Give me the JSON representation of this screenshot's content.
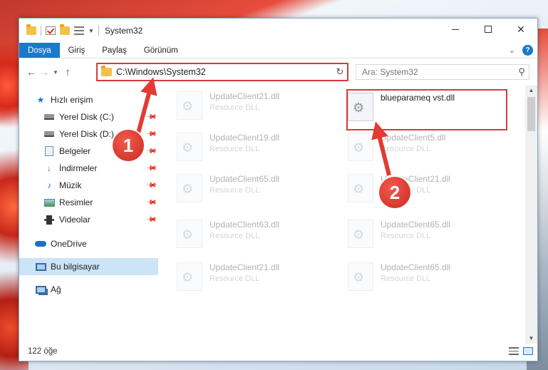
{
  "window": {
    "title": "System32"
  },
  "ribbon": {
    "tabs": [
      "Dosya",
      "Giriş",
      "Paylaş",
      "Görünüm"
    ]
  },
  "address": {
    "path": "C:\\Windows\\System32"
  },
  "search": {
    "placeholder": "Ara: System32"
  },
  "sidebar": {
    "quick_access": "Hızlı erişim",
    "items": [
      "Yerel Disk (C:)",
      "Yerel Disk (D:)",
      "Belgeler",
      "İndirmeler",
      "Müzik",
      "Resimler",
      "Videolar"
    ],
    "onedrive": "OneDrive",
    "this_pc": "Bu bilgisayar",
    "network": "Ağ"
  },
  "files": {
    "left": [
      {
        "name": "UpdateClient21.dll",
        "type": "Resource DLL"
      },
      {
        "name": "UpdateClient19.dll",
        "type": "Resource DLL"
      },
      {
        "name": "UpdateClient65.dll",
        "type": "Resource DLL"
      },
      {
        "name": "UpdateClient63.dll",
        "type": "Resource DLL"
      },
      {
        "name": "UpdateClient21.dll",
        "type": "Resource DLL"
      }
    ],
    "right": [
      {
        "name": "blueparameq vst.dll",
        "type": ""
      },
      {
        "name": "UpdateClient5.dll",
        "type": "Resource DLL"
      },
      {
        "name": "UpdateClient21.dll",
        "type": "Resource DLL"
      },
      {
        "name": "UpdateClient65.dll",
        "type": "Resource DLL"
      },
      {
        "name": "UpdateClient65.dll",
        "type": "Resource DLL"
      }
    ]
  },
  "status": {
    "count": "122 öğe"
  },
  "callouts": [
    "1",
    "2"
  ],
  "colors": {
    "accent": "#1979ca",
    "highlight": "#d43c3c"
  }
}
